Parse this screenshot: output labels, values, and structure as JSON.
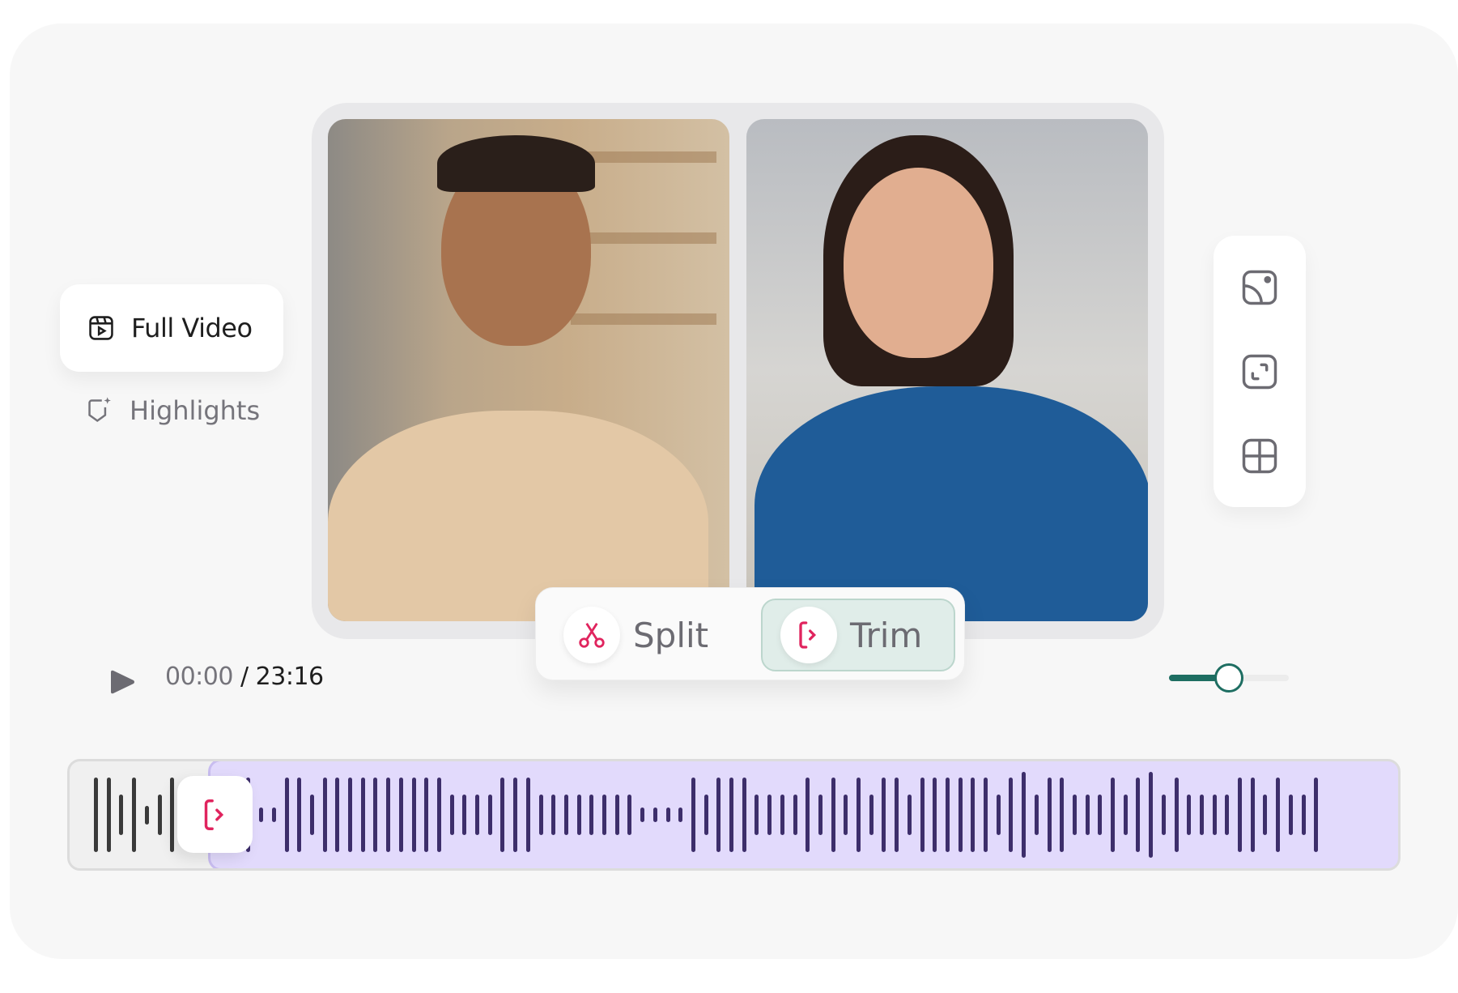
{
  "sidebar": {
    "items": [
      {
        "label": "Full Video",
        "icon": "video-reel-icon",
        "active": true
      },
      {
        "label": "Highlights",
        "icon": "shield-sparkle-icon",
        "active": false
      }
    ]
  },
  "toolbar": {
    "split_label": "Split",
    "trim_label": "Trim"
  },
  "player": {
    "current_time": "00:00",
    "separator": "/",
    "total_time": "23:16",
    "zoom_level": 0.5
  },
  "layout_options": [
    "picture-in-picture",
    "focus-speaker",
    "grid"
  ],
  "timeline": {
    "trim_start_fraction": 0.11,
    "waveform_levels": [
      1,
      1,
      0.55,
      1,
      0.25,
      0.55,
      1,
      0.55,
      1,
      1,
      0.55,
      1,
      1,
      0.2,
      0.2,
      1,
      1,
      0.55,
      1,
      1,
      1,
      1,
      1,
      1,
      1,
      1,
      1,
      1,
      0.55,
      0.55,
      0.55,
      0.55,
      1,
      1,
      1,
      0.55,
      0.55,
      0.55,
      0.55,
      0.55,
      0.55,
      0.55,
      0.55,
      0.2,
      0.2,
      0.2,
      0.2,
      1,
      0.55,
      1,
      1,
      1,
      0.55,
      0.55,
      0.55,
      0.55,
      1,
      0.55,
      1,
      0.55,
      1,
      0.55,
      1,
      1,
      0.55,
      1,
      1,
      1,
      1,
      1,
      1,
      0.55,
      1,
      1.15,
      0.55,
      1,
      1,
      0.55,
      0.55,
      0.55,
      1,
      0.55,
      1,
      1.15,
      0.55,
      1,
      0.55,
      0.55,
      0.55,
      0.55,
      1,
      1,
      0.55,
      1,
      0.55,
      0.55,
      1
    ]
  },
  "colors": {
    "accent": "#1e6e62",
    "trim_red": "#e0245e",
    "selection": "#e2dafc",
    "wave_active": "#3d2e6b",
    "wave_inactive": "#3a3a3a"
  }
}
